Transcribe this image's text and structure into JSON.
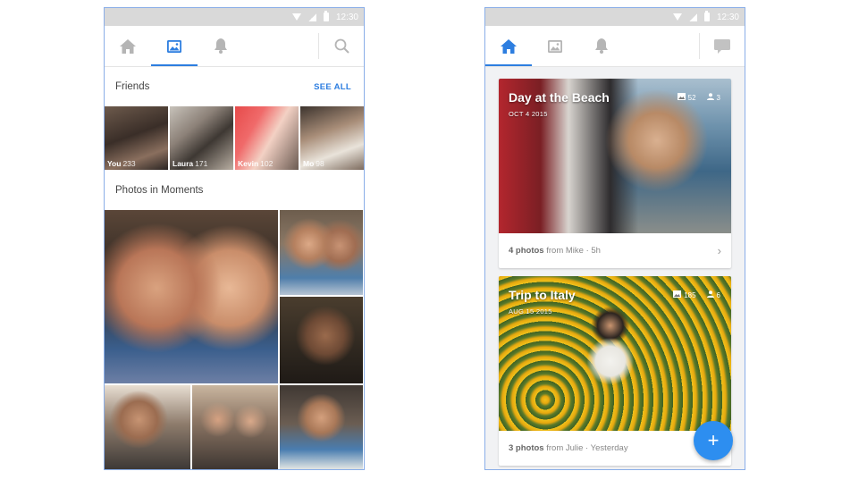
{
  "status_bar": {
    "time": "12:30"
  },
  "left_screen": {
    "nav": {
      "tabs": [
        "home-icon",
        "photos-icon",
        "notifications-icon"
      ],
      "active_tab": 1,
      "right": "search-icon"
    },
    "friends": {
      "title": "Friends",
      "see_all": "SEE ALL",
      "items": [
        {
          "name": "You",
          "count": "233"
        },
        {
          "name": "Laura",
          "count": "171"
        },
        {
          "name": "Kevin",
          "count": "102"
        },
        {
          "name": "Mo",
          "count": "98"
        }
      ]
    },
    "moments": {
      "title": "Photos in Moments"
    }
  },
  "right_screen": {
    "nav": {
      "tabs": [
        "home-icon",
        "photos-icon",
        "notifications-icon"
      ],
      "active_tab": 0,
      "right": "chat-icon"
    },
    "cards": [
      {
        "title": "Day at the Beach",
        "date": "OCT 4 2015",
        "photos": "52",
        "people": "3",
        "count_label": "4 photos",
        "from": "from Mike · 5h"
      },
      {
        "title": "Trip to Italy",
        "date": "AUG 15 2015",
        "photos": "185",
        "people": "6",
        "count_label": "3 photos",
        "from": "from Julie · Yesterday"
      }
    ],
    "fab_label": "+"
  },
  "colors": {
    "accent": "#2d7ee0",
    "fab": "#2d8ef0",
    "frame": "#8aaee8"
  }
}
